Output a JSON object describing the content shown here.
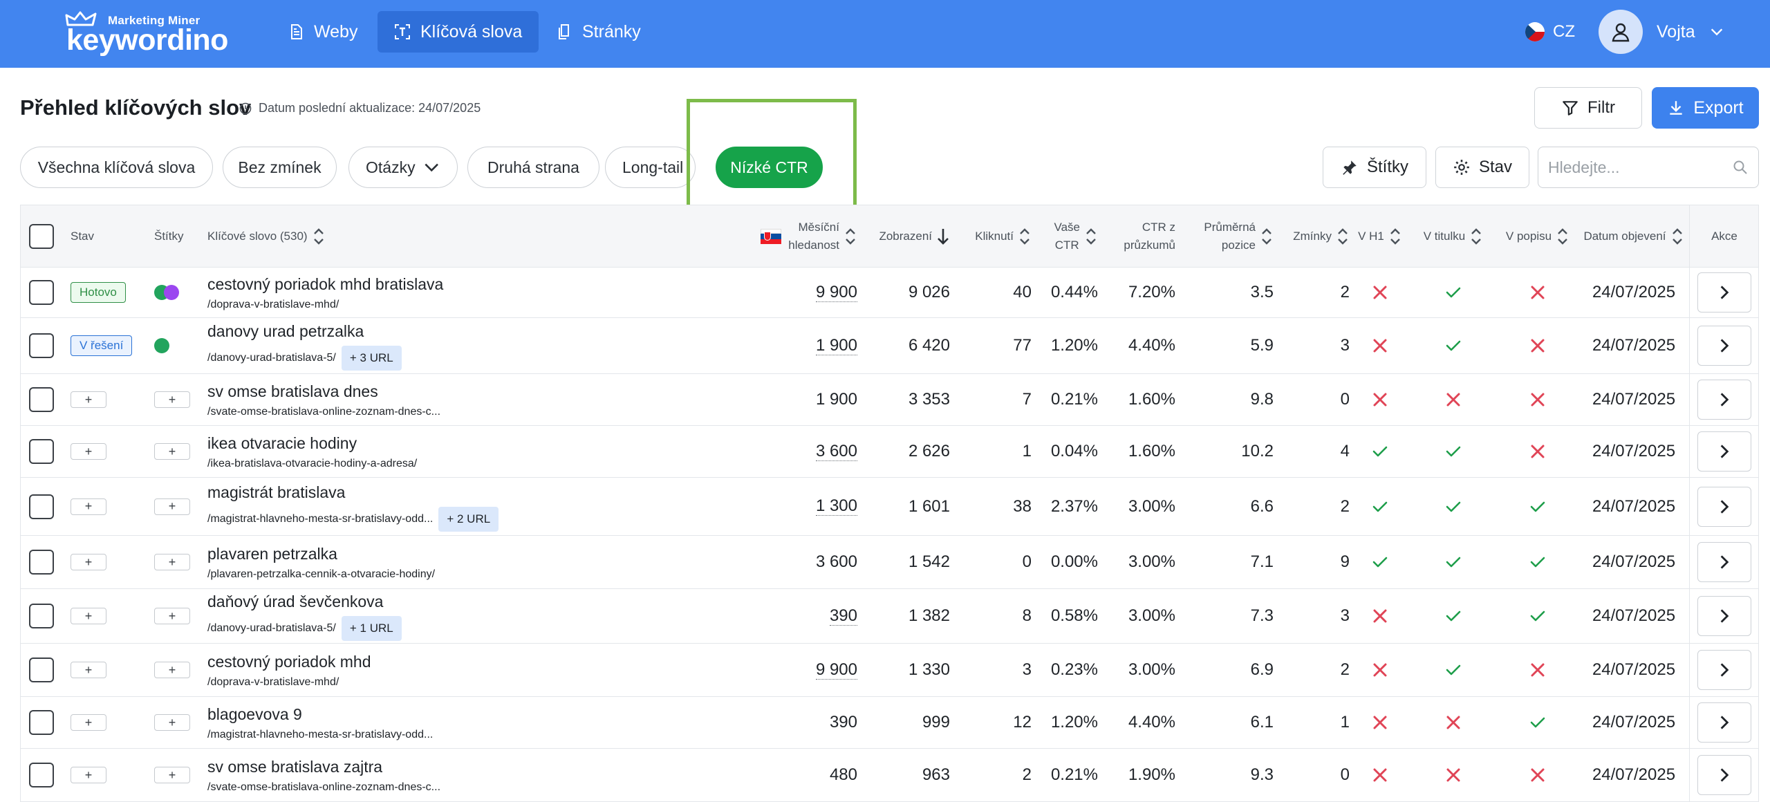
{
  "brand": {
    "small": "Marketing Miner",
    "big": "keywordino"
  },
  "nav": [
    {
      "label": "Weby",
      "icon": "document-icon",
      "active": false
    },
    {
      "label": "Klíčová slova",
      "icon": "scan-keyword-icon",
      "active": true
    },
    {
      "label": "Stránky",
      "icon": "pages-icon",
      "active": false
    }
  ],
  "language": "CZ",
  "user": {
    "name": "Vojta"
  },
  "page": {
    "title": "Přehled klíčových slov",
    "updated": "Datum poslední aktualizace: 24/07/2025",
    "filter_label": "Filtr",
    "export_label": "Export"
  },
  "chips": [
    {
      "label": "Všechna klíčová slova"
    },
    {
      "label": "Bez zmínek"
    },
    {
      "label": "Otázky"
    },
    {
      "label": "Druhá strana"
    },
    {
      "label": "Long-tail"
    },
    {
      "label": "Nízké CTR"
    }
  ],
  "toolbar": {
    "tags_label": "Štítky",
    "status_label": "Stav",
    "search_placeholder": "Hledejte..."
  },
  "columns": {
    "stav": "Stav",
    "stitky": "Štítky",
    "keyword": "Klíčové slovo (530)",
    "volume_1": "Měsíční",
    "volume_2": "hledanost",
    "impressions": "Zobrazení",
    "clicks": "Kliknutí",
    "ctr_1": "Vaše",
    "ctr_2": "CTR",
    "ctr_survey_1": "CTR z",
    "ctr_survey_2": "průzkumů",
    "position_1": "Průměrná",
    "position_2": "pozice",
    "mentions": "Zmínky",
    "h1": "V H1",
    "title": "V titulku",
    "desc": "V popisu",
    "date": "Datum objevení",
    "actions": "Akce"
  },
  "colors": {
    "accent": "#4285ef",
    "green": "#16a34a",
    "red_x": "#e04456",
    "check": "#1e9e4a"
  },
  "rows": [
    {
      "status": "Hotovo",
      "status_type": "done",
      "tags": [
        "#22a45d",
        "#9b47f0"
      ],
      "keyword": "cestovný poriadok mhd bratislava",
      "url": "/doprava-v-bratislave-mhd/",
      "url_badge": "",
      "volume": "9 900",
      "volume_underline": true,
      "impressions": "9 026",
      "clicks": "40",
      "ctr": "0.44%",
      "ctr_survey": "7.20%",
      "position": "3.5",
      "mentions": "2",
      "h1": false,
      "title": true,
      "desc": false,
      "date": "24/07/2025"
    },
    {
      "status": "V řešení",
      "status_type": "progress",
      "tags": [
        "#22a45d"
      ],
      "keyword": "danovy urad petrzalka",
      "url": "/danovy-urad-bratislava-5/",
      "url_badge": "+ 3 URL",
      "volume": "1 900",
      "volume_underline": true,
      "impressions": "6 420",
      "clicks": "77",
      "ctr": "1.20%",
      "ctr_survey": "4.40%",
      "position": "5.9",
      "mentions": "3",
      "h1": false,
      "title": true,
      "desc": false,
      "date": "24/07/2025"
    },
    {
      "status": "",
      "status_type": "none",
      "tags": [],
      "keyword": "sv omse bratislava dnes",
      "url": "/svate-omse-bratislava-online-zoznam-dnes-c...",
      "url_badge": "",
      "volume": "1 900",
      "volume_underline": false,
      "impressions": "3 353",
      "clicks": "7",
      "ctr": "0.21%",
      "ctr_survey": "1.60%",
      "position": "9.8",
      "mentions": "0",
      "h1": false,
      "title": false,
      "desc": false,
      "date": "24/07/2025"
    },
    {
      "status": "",
      "status_type": "none",
      "tags": [],
      "keyword": "ikea otvaracie hodiny",
      "url": "/ikea-bratislava-otvaracie-hodiny-a-adresa/",
      "url_badge": "",
      "volume": "3 600",
      "volume_underline": true,
      "impressions": "2 626",
      "clicks": "1",
      "ctr": "0.04%",
      "ctr_survey": "1.60%",
      "position": "10.2",
      "mentions": "4",
      "h1": true,
      "title": true,
      "desc": false,
      "date": "24/07/2025"
    },
    {
      "status": "",
      "status_type": "none",
      "tags": [],
      "keyword": "magistrát bratislava",
      "url": "/magistrat-hlavneho-mesta-sr-bratislavy-odd...",
      "url_badge": "+ 2 URL",
      "volume": "1 300",
      "volume_underline": true,
      "impressions": "1 601",
      "clicks": "38",
      "ctr": "2.37%",
      "ctr_survey": "3.00%",
      "position": "6.6",
      "mentions": "2",
      "h1": true,
      "title": true,
      "desc": true,
      "date": "24/07/2025"
    },
    {
      "status": "",
      "status_type": "none",
      "tags": [],
      "keyword": "plavaren petrzalka",
      "url": "/plavaren-petrzalka-cennik-a-otvaracie-hodiny/",
      "url_badge": "",
      "volume": "3 600",
      "volume_underline": false,
      "impressions": "1 542",
      "clicks": "0",
      "ctr": "0.00%",
      "ctr_survey": "3.00%",
      "position": "7.1",
      "mentions": "9",
      "h1": true,
      "title": true,
      "desc": true,
      "date": "24/07/2025"
    },
    {
      "status": "",
      "status_type": "none",
      "tags": [],
      "keyword": "daňový úrad ševčenkova",
      "url": "/danovy-urad-bratislava-5/",
      "url_badge": "+ 1 URL",
      "volume": "390",
      "volume_underline": true,
      "impressions": "1 382",
      "clicks": "8",
      "ctr": "0.58%",
      "ctr_survey": "3.00%",
      "position": "7.3",
      "mentions": "3",
      "h1": false,
      "title": true,
      "desc": true,
      "date": "24/07/2025"
    },
    {
      "status": "",
      "status_type": "none",
      "tags": [],
      "keyword": "cestovný poriadok mhd",
      "url": "/doprava-v-bratislave-mhd/",
      "url_badge": "",
      "volume": "9 900",
      "volume_underline": true,
      "impressions": "1 330",
      "clicks": "3",
      "ctr": "0.23%",
      "ctr_survey": "3.00%",
      "position": "6.9",
      "mentions": "2",
      "h1": false,
      "title": true,
      "desc": false,
      "date": "24/07/2025"
    },
    {
      "status": "",
      "status_type": "none",
      "tags": [],
      "keyword": "blagoevova 9",
      "url": "/magistrat-hlavneho-mesta-sr-bratislavy-odd...",
      "url_badge": "",
      "volume": "390",
      "volume_underline": false,
      "impressions": "999",
      "clicks": "12",
      "ctr": "1.20%",
      "ctr_survey": "4.40%",
      "position": "6.1",
      "mentions": "1",
      "h1": false,
      "title": false,
      "desc": true,
      "date": "24/07/2025"
    },
    {
      "status": "",
      "status_type": "none",
      "tags": [],
      "keyword": "sv omse bratislava zajtra",
      "url": "/svate-omse-bratislava-online-zoznam-dnes-c...",
      "url_badge": "",
      "volume": "480",
      "volume_underline": false,
      "impressions": "963",
      "clicks": "2",
      "ctr": "0.21%",
      "ctr_survey": "1.90%",
      "position": "9.3",
      "mentions": "0",
      "h1": false,
      "title": false,
      "desc": false,
      "date": "24/07/2025"
    }
  ]
}
